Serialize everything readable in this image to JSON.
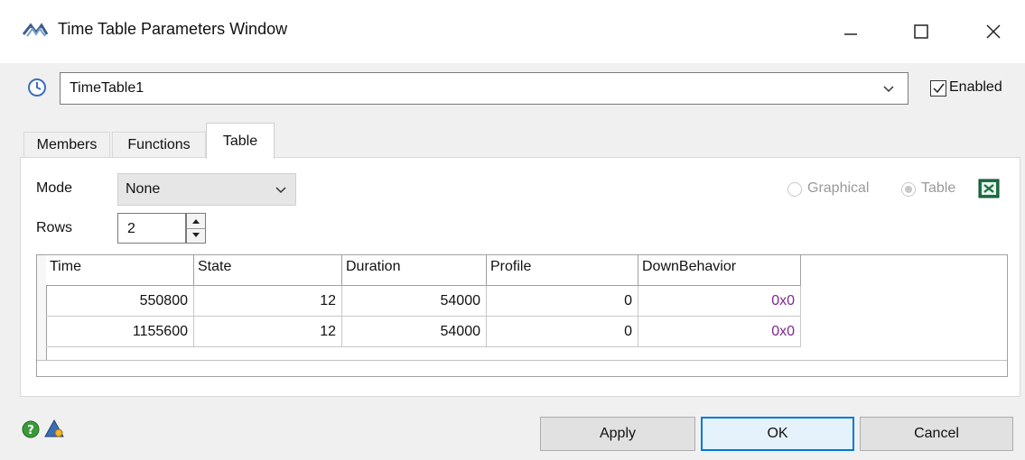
{
  "window": {
    "title": "Time Table Parameters Window",
    "icons": {
      "app": "flexsim-logo-icon",
      "minimize": "minimize-icon",
      "maximize": "maximize-icon",
      "close": "close-icon"
    }
  },
  "header": {
    "object_name": "TimeTable1",
    "enabled_label": "Enabled",
    "enabled_checked": true,
    "icon": "clock-icon"
  },
  "tabs": [
    {
      "label": "Members",
      "active": false
    },
    {
      "label": "Functions",
      "active": false
    },
    {
      "label": "Table",
      "active": true
    }
  ],
  "table_tab": {
    "mode_label": "Mode",
    "mode_value": "None",
    "rows_label": "Rows",
    "rows_value": "2",
    "view_options": {
      "graphical": "Graphical",
      "table": "Table",
      "selected": "Table"
    },
    "export_icon": "excel-icon"
  },
  "grid": {
    "columns": [
      "Time",
      "State",
      "Duration",
      "Profile",
      "DownBehavior"
    ],
    "rows": [
      [
        "550800",
        "12",
        "54000",
        "0",
        "0x0"
      ],
      [
        "1155600",
        "12",
        "54000",
        "0",
        "0x0"
      ]
    ]
  },
  "footer": {
    "help_icon": "help-icon",
    "tool_icon": "triangle-tool-icon",
    "apply": "Apply",
    "ok": "OK",
    "cancel": "Cancel"
  },
  "colors": {
    "accent": "#0078d7",
    "hex_value": "#7d2a8f"
  }
}
